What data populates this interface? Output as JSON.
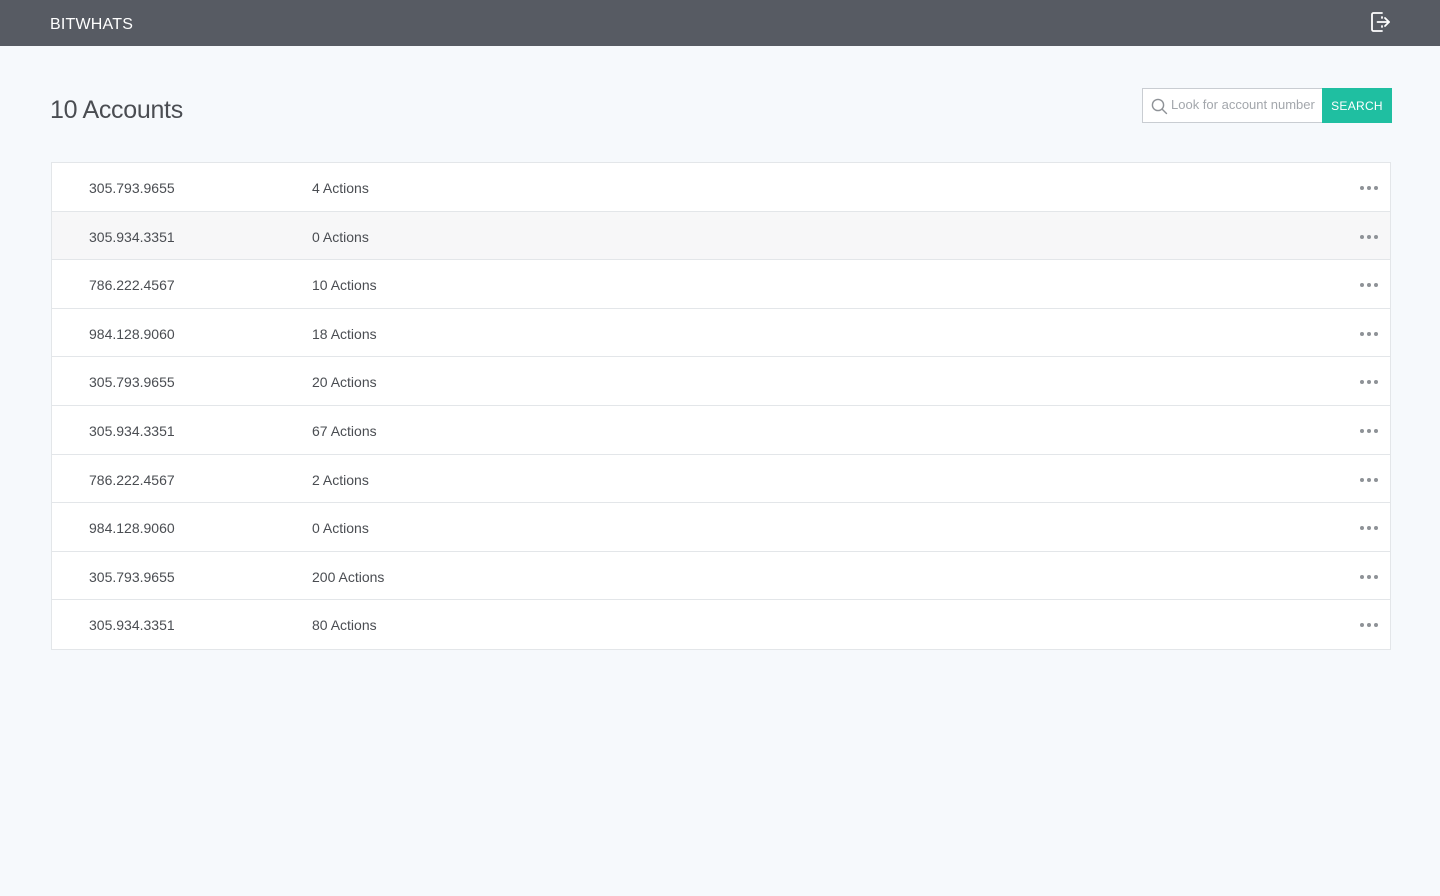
{
  "app": {
    "brand": "BITWHATS"
  },
  "icons": {
    "logout": "logout-icon",
    "search": "search-icon",
    "more": "more-horizontal-icon"
  },
  "colors": {
    "topbar": "#575b63",
    "accent": "#1fbfa1",
    "background": "#f6f9fc"
  },
  "page": {
    "title": "10 Accounts"
  },
  "search": {
    "placeholder": "Look for account number",
    "value": "",
    "button_label": "SEARCH"
  },
  "accounts": [
    {
      "number": "305.793.9655",
      "actions": "4 Actions"
    },
    {
      "number": "305.934.3351",
      "actions": "0 Actions"
    },
    {
      "number": "786.222.4567",
      "actions": "10 Actions"
    },
    {
      "number": "984.128.9060",
      "actions": "18 Actions"
    },
    {
      "number": "305.793.9655",
      "actions": "20 Actions"
    },
    {
      "number": "305.934.3351",
      "actions": "67 Actions"
    },
    {
      "number": "786.222.4567",
      "actions": "2 Actions"
    },
    {
      "number": "984.128.9060",
      "actions": "0 Actions"
    },
    {
      "number": "305.793.9655",
      "actions": "200 Actions"
    },
    {
      "number": "305.934.3351",
      "actions": "80 Actions"
    }
  ]
}
